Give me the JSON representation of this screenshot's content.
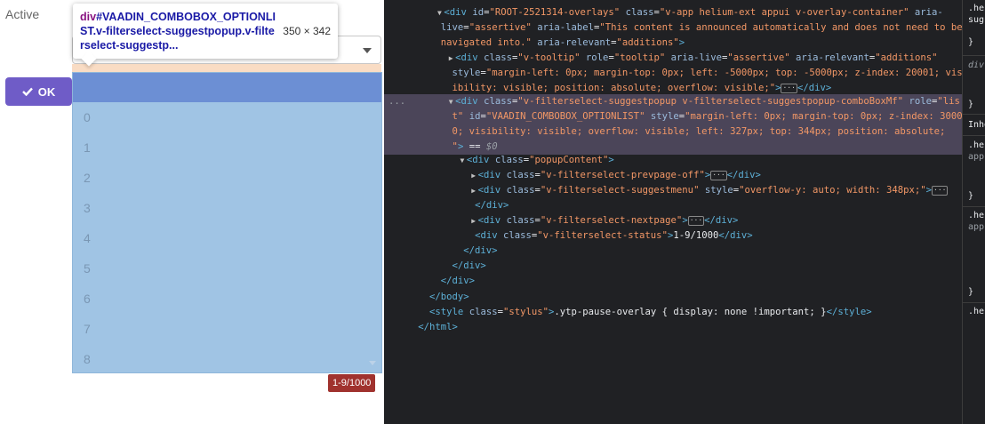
{
  "app": {
    "active_label": "Active",
    "ok_label": "OK",
    "popup_items": [
      "0",
      "1",
      "2",
      "3",
      "4",
      "5",
      "6",
      "7",
      "8"
    ],
    "status": "1-9/1000",
    "accent_color": "#6f5cc7",
    "status_color": "#a0322e"
  },
  "tooltip": {
    "tag": "div",
    "selector": "#VAADIN_COMBOBOX_OPTIONLIST.v-filterselect-suggestpopup.v-filterselect-suggestp...",
    "size": "350 × 342"
  },
  "devtools": {
    "lines": [
      "<div id=\"ROOT-2521314-overlays\" class=\"v-app helium-ext appui v-overlay-container\" aria-",
      "live=\"assertive\" aria-label=\"This content is announced automatically and does not need to be",
      "navigated into.\" aria-relevant=\"additions\">",
      "<div class=\"v-tooltip\" role=\"tooltip\" aria-live=\"assertive\" aria-relevant=\"additions\"",
      "style=\"margin-left: 0px; margin-top: 0px; left: -5000px; top: -5000px; z-index: 20001; vis",
      "ibility: visible; position: absolute; overflow: visible;\"> </div>",
      "<div class=\"v-filterselect-suggestpopup v-filterselect-suggestpopup-comboBoxMf\" role=\"lis",
      "t\" id=\"VAADIN_COMBOBOX_OPTIONLIST\" style=\"margin-left: 0px; margin-top: 0px; z-index: 3000",
      "0; visibility: visible; overflow: visible; left: 327px; top: 344px; position: absolute;",
      "\"> == $0",
      "<div class=\"popupContent\">",
      "<div class=\"v-filterselect-prevpage-off\"> </div>",
      "<div class=\"v-filterselect-suggestmenu\" style=\"overflow-y: auto; width: 348px;\">",
      "</div>",
      "<div class=\"v-filterselect-nextpage\"> </div>",
      "<div class=\"v-filterselect-status\">1-9/1000</div>",
      "</div>",
      "</div>",
      "</div>",
      "</body>",
      "<style class=\"stylus\">.ytp-pause-overlay { display: none !important; }</style>",
      "</html>"
    ],
    "selected_dots": "..."
  },
  "styles_pane": {
    "lines": [
      ".he",
      "sug",
      "}",
      "div",
      "{",
      "}",
      "Inhe",
      ".he",
      "app",
      "{",
      "}",
      ".he",
      "app",
      "}",
      ".he"
    ]
  }
}
